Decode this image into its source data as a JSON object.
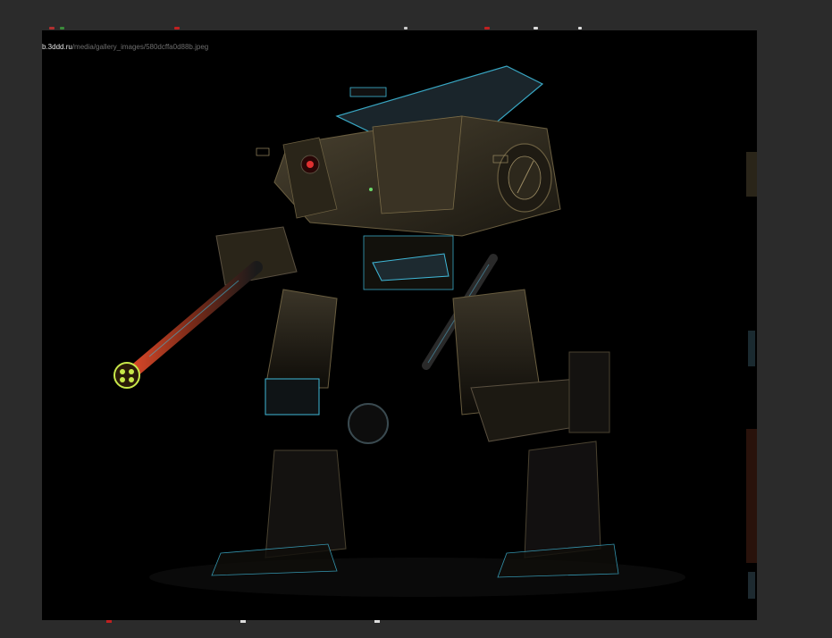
{
  "image": {
    "url_domain": "b.3ddd.ru",
    "url_path": "/media/gallery_images/580dcffa0d88b.jpeg"
  },
  "colors": {
    "background": "#2b2b2b",
    "canvas": "#000000",
    "mech_body": "#3a3324",
    "mech_highlight": "#3fb8d8",
    "barrel_glow": "#e0452a",
    "muzzle_green": "#c8e84a"
  }
}
